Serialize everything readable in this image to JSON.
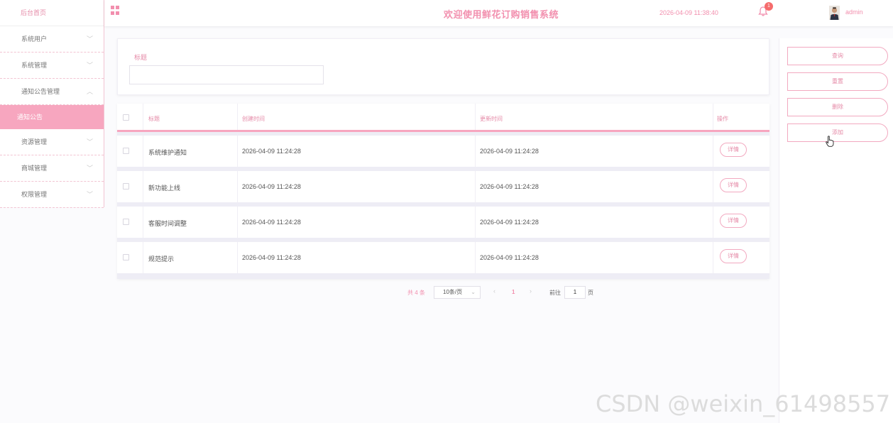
{
  "sidebar": {
    "home": "后台首页",
    "items": [
      {
        "label": "系统用户",
        "chevron": "﹀"
      },
      {
        "label": "系统管理",
        "chevron": "﹀"
      },
      {
        "label": "通知公告管理",
        "chevron": "︿"
      },
      {
        "label": "资源管理",
        "chevron": "﹀"
      },
      {
        "label": "商城管理",
        "chevron": "﹀"
      },
      {
        "label": "权限管理",
        "chevron": "﹀"
      }
    ],
    "active_sub": "通知公告"
  },
  "header": {
    "title": "欢迎使用鲜花订购销售系统",
    "datetime": "2026-04-09 11:38:40",
    "notification_count": "1",
    "username": "admin"
  },
  "search": {
    "label": "标题",
    "placeholder": ""
  },
  "table": {
    "headers": [
      "标题",
      "创建时间",
      "更新时间",
      "操作"
    ],
    "rows": [
      {
        "title": "系统维护通知",
        "created": "2026-04-09 11:24:28",
        "updated": "2026-04-09 11:24:28",
        "action": "详情"
      },
      {
        "title": "新功能上线",
        "created": "2026-04-09 11:24:28",
        "updated": "2026-04-09 11:24:28",
        "action": "详情"
      },
      {
        "title": "客服时间调整",
        "created": "2026-04-09 11:24:28",
        "updated": "2026-04-09 11:24:28",
        "action": "详情"
      },
      {
        "title": "规范提示",
        "created": "2026-04-09 11:24:28",
        "updated": "2026-04-09 11:24:28",
        "action": "详情"
      }
    ]
  },
  "pagination": {
    "total": "共 4 条",
    "page_size": "10条/页",
    "size_caret": "⌄",
    "prev": "‹",
    "current": "1",
    "next": "›",
    "goto_label": "前往",
    "goto_value": "1",
    "page_label": "页"
  },
  "actions": {
    "query": "查询",
    "reset": "重置",
    "delete": "删除",
    "add": "添加"
  },
  "watermark": "CSDN @weixin_61498557",
  "colors": {
    "accent": "#f28fae",
    "active_bg": "#f7a6bf",
    "border": "#f2a9c0"
  }
}
